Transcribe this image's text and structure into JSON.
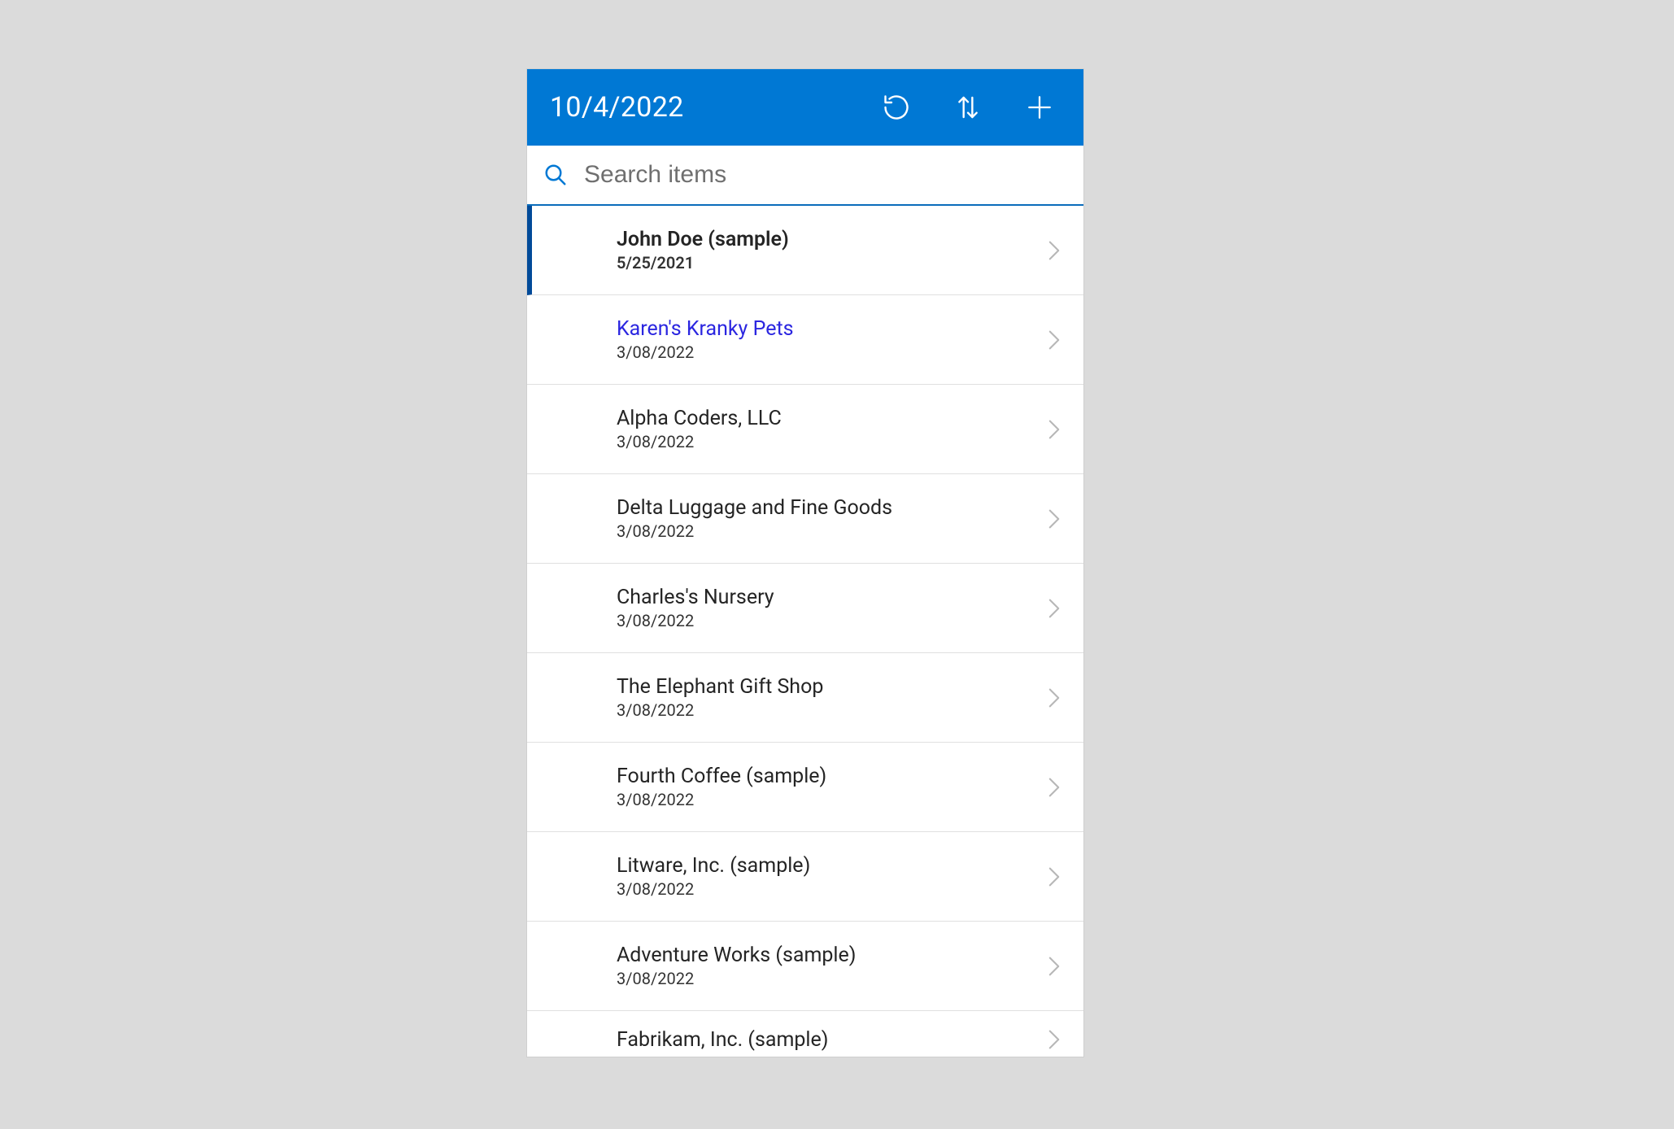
{
  "header": {
    "title": "10/4/2022"
  },
  "search": {
    "placeholder": "Search items"
  },
  "colors": {
    "headerBg": "#0078d4",
    "selectedBorder": "#004a99",
    "linkHighlight": "#2b26e0"
  },
  "items": [
    {
      "title": "John Doe (sample)",
      "date": "5/25/2021",
      "selected": true,
      "highlight": false
    },
    {
      "title": "Karen's Kranky Pets",
      "date": "3/08/2022",
      "selected": false,
      "highlight": true
    },
    {
      "title": "Alpha Coders, LLC",
      "date": "3/08/2022",
      "selected": false,
      "highlight": false
    },
    {
      "title": "Delta Luggage and Fine Goods",
      "date": "3/08/2022",
      "selected": false,
      "highlight": false
    },
    {
      "title": "Charles's Nursery",
      "date": "3/08/2022",
      "selected": false,
      "highlight": false
    },
    {
      "title": "The Elephant Gift Shop",
      "date": "3/08/2022",
      "selected": false,
      "highlight": false
    },
    {
      "title": "Fourth Coffee (sample)",
      "date": "3/08/2022",
      "selected": false,
      "highlight": false
    },
    {
      "title": "Litware, Inc. (sample)",
      "date": "3/08/2022",
      "selected": false,
      "highlight": false
    },
    {
      "title": "Adventure Works (sample)",
      "date": "3/08/2022",
      "selected": false,
      "highlight": false
    },
    {
      "title": "Fabrikam, Inc. (sample)",
      "date": "",
      "selected": false,
      "highlight": false,
      "partial": true
    }
  ]
}
